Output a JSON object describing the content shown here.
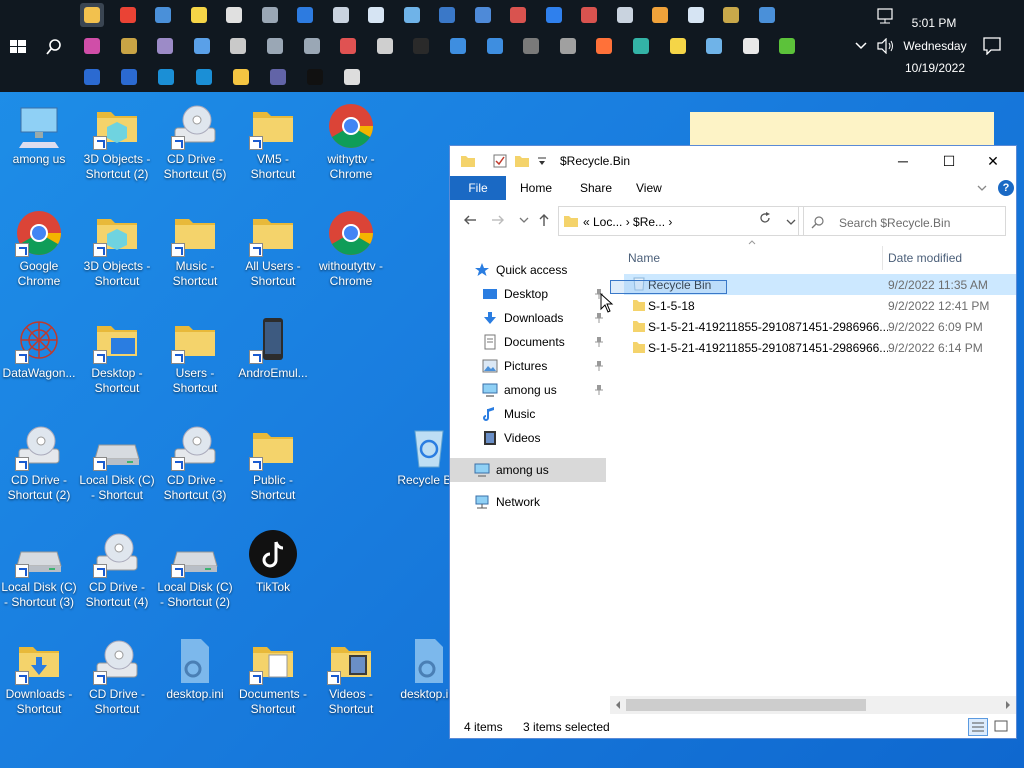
{
  "taskbar": {
    "row1_apps": [
      {
        "name": "file-explorer",
        "color": "#f2c14e",
        "active": true
      },
      {
        "name": "chrome",
        "color": "#ea4335"
      },
      {
        "name": "monitor",
        "color": "#4a90d9"
      },
      {
        "name": "sticky-notes",
        "color": "#f5d547"
      },
      {
        "name": "settings",
        "color": "#e0e0e0"
      },
      {
        "name": "app",
        "color": "#9aa7b5"
      },
      {
        "name": "internet-explorer",
        "color": "#2d7be0"
      },
      {
        "name": "edit",
        "color": "#c9d3df"
      },
      {
        "name": "notepad",
        "color": "#d6e4f3"
      },
      {
        "name": "paint",
        "color": "#6fb3e8"
      },
      {
        "name": "remote",
        "color": "#3a78c8"
      },
      {
        "name": "app2",
        "color": "#4e8ad8"
      },
      {
        "name": "red-app",
        "color": "#d9534f"
      },
      {
        "name": "blue-app",
        "color": "#2f80ed"
      },
      {
        "name": "calendar",
        "color": "#d9534f"
      },
      {
        "name": "printer",
        "color": "#c9d3df"
      },
      {
        "name": "media",
        "color": "#f0a23a"
      },
      {
        "name": "doc",
        "color": "#d6e4f3"
      },
      {
        "name": "disc",
        "color": "#c8a84a"
      },
      {
        "name": "control",
        "color": "#4a90d9"
      }
    ],
    "row2_apps": [
      {
        "name": "app-a",
        "color": "#d04ea8"
      },
      {
        "name": "app-b",
        "color": "#c9a445"
      },
      {
        "name": "app-c",
        "color": "#9c8bc7"
      },
      {
        "name": "magnifier",
        "color": "#5aa0e8"
      },
      {
        "name": "app-d",
        "color": "#c9c9c9"
      },
      {
        "name": "app-e",
        "color": "#9aa7b5"
      },
      {
        "name": "app-f",
        "color": "#9aa7b5"
      },
      {
        "name": "opera-like",
        "color": "#e05252"
      },
      {
        "name": "app-g",
        "color": "#cfcfcf"
      },
      {
        "name": "terminal",
        "color": "#2a2a2a"
      },
      {
        "name": "monitor-2",
        "color": "#3e8ee0"
      },
      {
        "name": "cortana",
        "color": "#3e8ee0"
      },
      {
        "name": "calculator",
        "color": "#7a7a7a"
      },
      {
        "name": "camera",
        "color": "#a0a0a0"
      },
      {
        "name": "firefox",
        "color": "#ff7139"
      },
      {
        "name": "edge",
        "color": "#33b3a6"
      },
      {
        "name": "notes",
        "color": "#f5d547"
      },
      {
        "name": "app-h",
        "color": "#6fb3e8"
      },
      {
        "name": "security",
        "color": "#e8e8e8"
      },
      {
        "name": "green-app",
        "color": "#5cc23a"
      }
    ],
    "row3_apps": [
      {
        "name": "powershell",
        "color": "#2b6ad1"
      },
      {
        "name": "powershell-2",
        "color": "#2b6ad1"
      },
      {
        "name": "powershell-3",
        "color": "#1b8fd6"
      },
      {
        "name": "powershell-4",
        "color": "#1b8fd6"
      },
      {
        "name": "store",
        "color": "#f4c542"
      },
      {
        "name": "teams",
        "color": "#6264a7"
      },
      {
        "name": "tiktok",
        "color": "#111111"
      },
      {
        "name": "roblox",
        "color": "#dddddd"
      }
    ],
    "clock": {
      "time": "5:01 PM",
      "day": "Wednesday",
      "date": "10/19/2022"
    }
  },
  "desktop": {
    "icons": [
      {
        "label": "among us",
        "kind": "pc",
        "shortcut": false
      },
      {
        "label": "3D Objects - Shortcut (2)",
        "kind": "folder3d",
        "shortcut": true
      },
      {
        "label": "CD Drive - Shortcut (5)",
        "kind": "cd",
        "shortcut": true
      },
      {
        "label": "VM5 - Shortcut",
        "kind": "folder",
        "shortcut": true
      },
      {
        "label": "withyttv - Chrome",
        "kind": "chrome",
        "shortcut": false
      },
      {
        "label": "Google Chrome",
        "kind": "chrome",
        "shortcut": true
      },
      {
        "label": "3D Objects - Shortcut",
        "kind": "folder3d",
        "shortcut": true
      },
      {
        "label": "Music - Shortcut",
        "kind": "folder",
        "shortcut": true
      },
      {
        "label": "All Users - Shortcut",
        "kind": "folder",
        "shortcut": true
      },
      {
        "label": "withoutyttv - Chrome",
        "kind": "chrome",
        "shortcut": false
      },
      {
        "label": "DataWagon...",
        "kind": "datawagon",
        "shortcut": true
      },
      {
        "label": "Desktop - Shortcut",
        "kind": "folderdesk",
        "shortcut": true
      },
      {
        "label": "Users - Shortcut",
        "kind": "folder",
        "shortcut": true
      },
      {
        "label": "AndroEmul...",
        "kind": "phone",
        "shortcut": true
      },
      {
        "label": "CD Drive - Shortcut (2)",
        "kind": "cd",
        "shortcut": true
      },
      {
        "label": "Local Disk (C) - Shortcut",
        "kind": "disk",
        "shortcut": true
      },
      {
        "label": "CD Drive - Shortcut (3)",
        "kind": "cd",
        "shortcut": true
      },
      {
        "label": "Public - Shortcut",
        "kind": "folder",
        "shortcut": true
      },
      {
        "label": "Recycle Bin",
        "kind": "recycle",
        "shortcut": false
      },
      {
        "label": "Local Disk (C) - Shortcut (3)",
        "kind": "disk",
        "shortcut": true
      },
      {
        "label": "CD Drive - Shortcut (4)",
        "kind": "cd",
        "shortcut": true
      },
      {
        "label": "Local Disk (C) - Shortcut (2)",
        "kind": "disk",
        "shortcut": true
      },
      {
        "label": "TikTok",
        "kind": "tiktok",
        "shortcut": false
      },
      {
        "label": "Downloads - Shortcut",
        "kind": "folderdown",
        "shortcut": true
      },
      {
        "label": "CD Drive - Shortcut",
        "kind": "cd",
        "shortcut": true
      },
      {
        "label": "desktop.ini",
        "kind": "ini",
        "shortcut": false
      },
      {
        "label": "Documents - Shortcut",
        "kind": "folderdoc",
        "shortcut": true
      },
      {
        "label": "Videos - Shortcut",
        "kind": "foldervid",
        "shortcut": true
      },
      {
        "label": "desktop.ini",
        "kind": "ini",
        "shortcut": false
      }
    ]
  },
  "explorer": {
    "title": "$Recycle.Bin",
    "window_buttons": {
      "minimize": "─",
      "maximize": "☐",
      "close": "✕"
    },
    "ribbon_tabs": [
      "File",
      "Home",
      "Share",
      "View"
    ],
    "help": "?",
    "address": "«  Loc...  ›  $Re...  ›",
    "search_placeholder": "Search $Recycle.Bin",
    "nav": [
      {
        "label": "Quick access",
        "icon": "star",
        "indent": 1,
        "pinned": false
      },
      {
        "label": "Desktop",
        "icon": "desktop",
        "indent": 2,
        "pinned": true
      },
      {
        "label": "Downloads",
        "icon": "downloads",
        "indent": 2,
        "pinned": true
      },
      {
        "label": "Documents",
        "icon": "documents",
        "indent": 2,
        "pinned": true
      },
      {
        "label": "Pictures",
        "icon": "pictures",
        "indent": 2,
        "pinned": true
      },
      {
        "label": "among us",
        "icon": "pc",
        "indent": 2,
        "pinned": true
      },
      {
        "label": "Music",
        "icon": "music",
        "indent": 2,
        "pinned": false
      },
      {
        "label": "Videos",
        "icon": "videos",
        "indent": 2,
        "pinned": false
      },
      {
        "label": "among us",
        "icon": "pc",
        "indent": 1,
        "pinned": false,
        "selected": true
      },
      {
        "label": "Network",
        "icon": "network",
        "indent": 1,
        "pinned": false
      }
    ],
    "columns": {
      "name": "Name",
      "date": "Date modified"
    },
    "files": [
      {
        "name": "Recycle Bin",
        "date": "9/2/2022 11:35 AM",
        "icon": "recycle",
        "selected": true
      },
      {
        "name": "S-1-5-18",
        "date": "9/2/2022 12:41 PM",
        "icon": "folder",
        "selected": false
      },
      {
        "name": "S-1-5-21-419211855-2910871451-2986966...",
        "date": "9/2/2022 6:09 PM",
        "icon": "folder",
        "selected": false
      },
      {
        "name": "S-1-5-21-419211855-2910871451-2986966...",
        "date": "9/2/2022 6:14 PM",
        "icon": "folder",
        "selected": false
      }
    ],
    "drag_label": "Recycle Bin",
    "status": {
      "items": "4 items",
      "selected": "3 items selected"
    }
  },
  "colors": {
    "accent": "#1a69c4",
    "selection": "#cce8ff",
    "folder": "#f4d36b"
  }
}
